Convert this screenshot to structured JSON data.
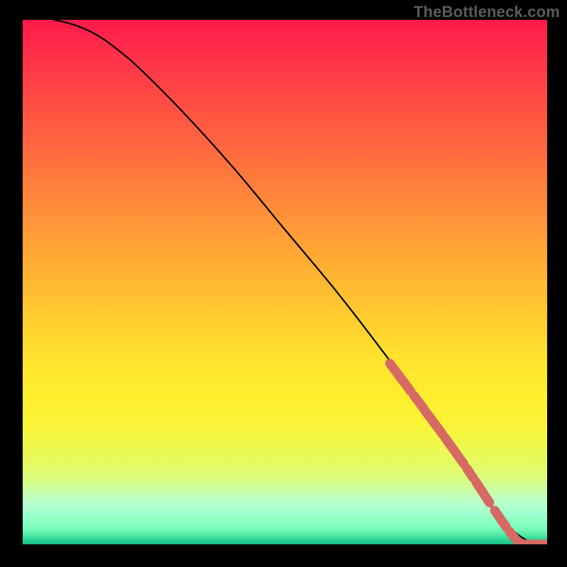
{
  "source_label": "TheBottleneck.com",
  "chart_data": {
    "type": "line",
    "title": "",
    "xlabel": "",
    "ylabel": "",
    "xlim": [
      0,
      100
    ],
    "ylim": [
      0,
      100
    ],
    "grid": false,
    "series": [
      {
        "name": "curve",
        "color": "#000000",
        "x": [
          6,
          9,
          12,
          15,
          18,
          22,
          30,
          40,
          50,
          60,
          70,
          78,
          84,
          88,
          91,
          93.5,
          95.5,
          97,
          98.2,
          99.2,
          100
        ],
        "y": [
          100,
          99.3,
          98.2,
          96.6,
          94.4,
          91,
          83,
          72,
          60,
          48,
          35,
          24,
          15,
          9,
          5,
          2.6,
          1.1,
          0.35,
          0,
          0,
          0
        ]
      },
      {
        "name": "highlighted-segment",
        "color": "#d66a63",
        "style": "thick-dashed",
        "dash_pattern": [
          4.0,
          0.6,
          1.8,
          0.4,
          3.2,
          0.5,
          3.6,
          0.6,
          1.2,
          0.5,
          2.6,
          1.0,
          2.2,
          0.6,
          1.2,
          0.5,
          0.6,
          0.5,
          2.8,
          0.7,
          0.6,
          1.0,
          0.6,
          1.0,
          0.6,
          1.0,
          0.6,
          0.6,
          0.4,
          1.9,
          0.5,
          1.0,
          0.5,
          0.5
        ],
        "x": [
          70.0,
          73.9,
          74.5,
          76.3,
          76.7,
          79.9,
          80.4,
          84.0,
          84.6,
          85.8,
          86.3,
          88.9,
          89.9,
          92.1,
          92.7,
          93.9,
          94.4,
          95.0,
          95.5,
          98.3,
          99.0,
          99.3,
          99.8,
          100.0
        ],
        "y": [
          34.5,
          29.3,
          28.5,
          26.1,
          25.5,
          21.2,
          20.5,
          15.5,
          14.6,
          12.8,
          12.1,
          8.1,
          6.6,
          3.4,
          2.6,
          1.1,
          0.5,
          0.12,
          0,
          0,
          0,
          0,
          0,
          0
        ]
      }
    ],
    "background": {
      "type": "vertical-gradient",
      "stops": [
        {
          "pos": 0.0,
          "color": "#ff1a4a"
        },
        {
          "pos": 0.36,
          "color": "#ff8d3a"
        },
        {
          "pos": 0.66,
          "color": "#ffe62d"
        },
        {
          "pos": 0.88,
          "color": "#d6fd85"
        },
        {
          "pos": 0.97,
          "color": "#78fbb9"
        },
        {
          "pos": 1.0,
          "color": "#1abf88"
        }
      ]
    }
  }
}
